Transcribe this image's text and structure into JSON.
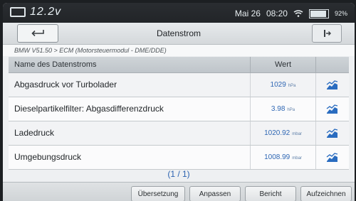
{
  "status": {
    "voltage": "12.2v",
    "date": "Mai 26",
    "time": "08:20",
    "battery": "92%",
    "battery_level": 0.92
  },
  "header": {
    "title": "Datenstrom"
  },
  "breadcrumb": "BMW V51.50 > ECM (Motorsteuermodul - DME/DDE)",
  "table": {
    "col_name": "Name des Datenstroms",
    "col_value": "Wert",
    "rows": [
      {
        "name": "Abgasdruck vor Turbolader",
        "value": "1029",
        "unit": "hPa"
      },
      {
        "name": "Dieselpartikelfilter: Abgasdifferenzdruck",
        "value": "3.98",
        "unit": "hPa"
      },
      {
        "name": "Ladedruck",
        "value": "1020.92",
        "unit": "mbar"
      },
      {
        "name": "Umgebungsdruck",
        "value": "1008.99",
        "unit": "mbar"
      }
    ]
  },
  "pager": "(1 / 1)",
  "toolbar": {
    "uebersetzung": "Übersetzung",
    "anpassen": "Anpassen",
    "bericht": "Bericht",
    "aufzeichnen": "Aufzeichnen"
  },
  "colors": {
    "value_blue": "#2f67b4",
    "graph_icon_blue": "#2a6cc0"
  },
  "icons": [
    "back-arrow-icon",
    "exit-icon",
    "graph-icon",
    "wifi-icon",
    "battery-icon"
  ]
}
